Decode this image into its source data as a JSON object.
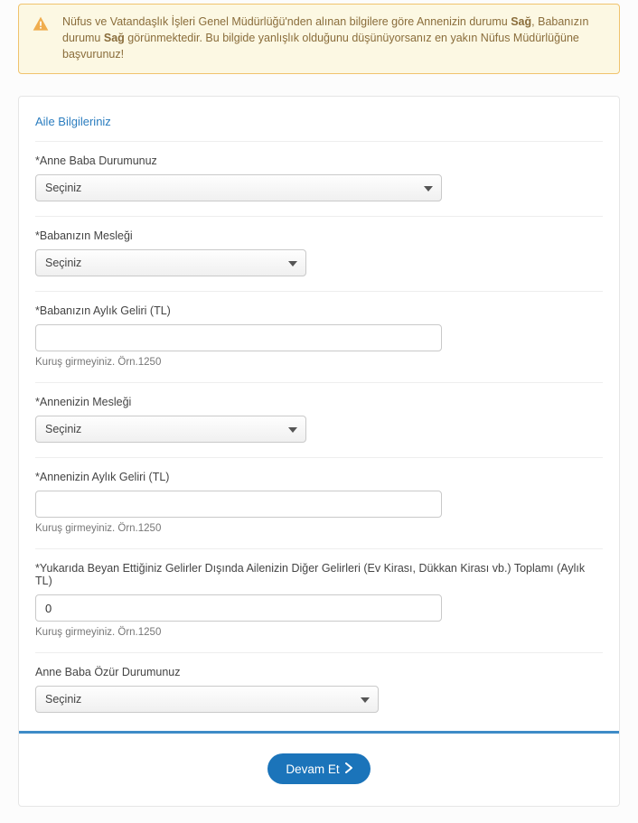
{
  "alert": {
    "text_before_mother": "Nüfus ve Vatandaşlık İşleri Genel Müdürlüğü'nden alınan bilgilere göre Annenizin durumu ",
    "mother_status": "Sağ",
    "text_between": ", Babanızın durumu ",
    "father_status": "Sağ",
    "text_after": " görünmektedir. Bu bilgide yanlışlık olduğunu düşünüyorsanız en yakın Nüfus Müdürlüğüne başvurunuz!"
  },
  "section_title": "Aile Bilgileriniz",
  "fields": {
    "parents_status": {
      "label": "*Anne Baba Durumunuz",
      "selected": "Seçiniz"
    },
    "father_job": {
      "label": "*Babanızın Mesleği",
      "selected": "Seçiniz"
    },
    "father_income": {
      "label": "*Babanızın Aylık Geliri (TL)",
      "value": "",
      "help": "Kuruş girmeyiniz. Örn.1250"
    },
    "mother_job": {
      "label": "*Annenizin Mesleği",
      "selected": "Seçiniz"
    },
    "mother_income": {
      "label": "*Annenizin Aylık Geliri (TL)",
      "value": "",
      "help": "Kuruş girmeyiniz. Örn.1250"
    },
    "other_income": {
      "label": "*Yukarıda Beyan Ettiğiniz Gelirler Dışında Ailenizin Diğer Gelirleri (Ev Kirası, Dükkan Kirası vb.) Toplamı (Aylık TL)",
      "value": "0",
      "help": "Kuruş girmeyiniz. Örn.1250"
    },
    "disability": {
      "label": "Anne Baba Özür Durumunuz",
      "selected": "Seçiniz"
    }
  },
  "button": {
    "label": "Devam Et"
  }
}
